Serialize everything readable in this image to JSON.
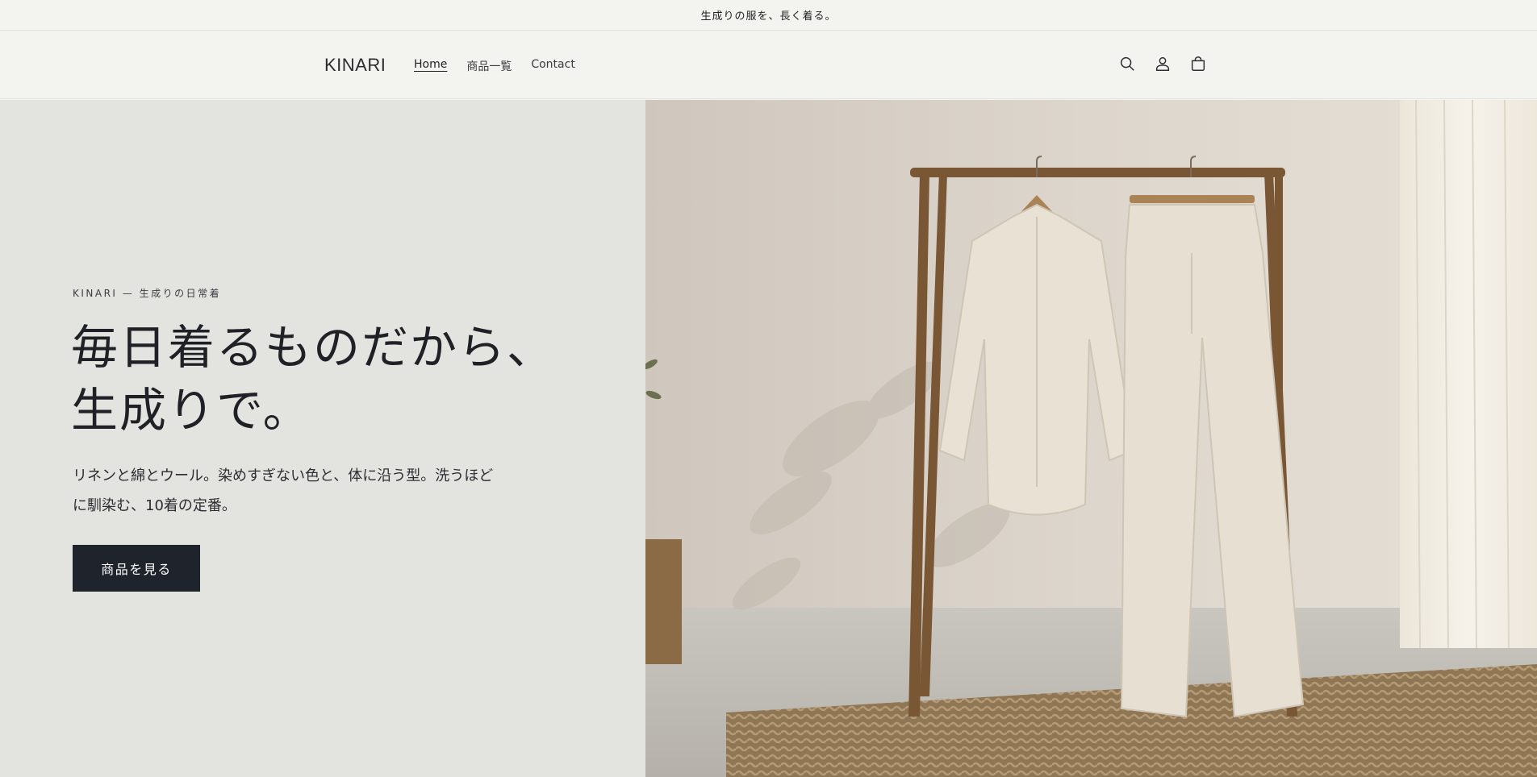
{
  "announcement": {
    "text": "生成りの服を、長く着る。"
  },
  "header": {
    "logo": "KINARI",
    "nav": [
      {
        "label": "Home",
        "active": true
      },
      {
        "label": "商品一覧",
        "active": false
      },
      {
        "label": "Contact",
        "active": false
      }
    ],
    "icons": [
      "search-icon",
      "account-icon",
      "cart-icon"
    ]
  },
  "hero": {
    "eyebrow": "KINARI — 生成りの日常着",
    "title_line1": "毎日着るものだから、",
    "title_line2": "生成りで。",
    "description_line1": "リネンと綿とウール。染めすぎない色と、体に沿う型。洗うほど",
    "description_line2": "に馴染む、10着の定番。",
    "cta_label": "商品を見る",
    "image_subject": "hero-photo-linen-shirt-and-trousers-on-wooden-rack"
  },
  "colors": {
    "background": "#f3f3ef",
    "hero_left_bg": "#e3e3df",
    "button_bg": "#1f232c",
    "text": "#1f2126"
  }
}
